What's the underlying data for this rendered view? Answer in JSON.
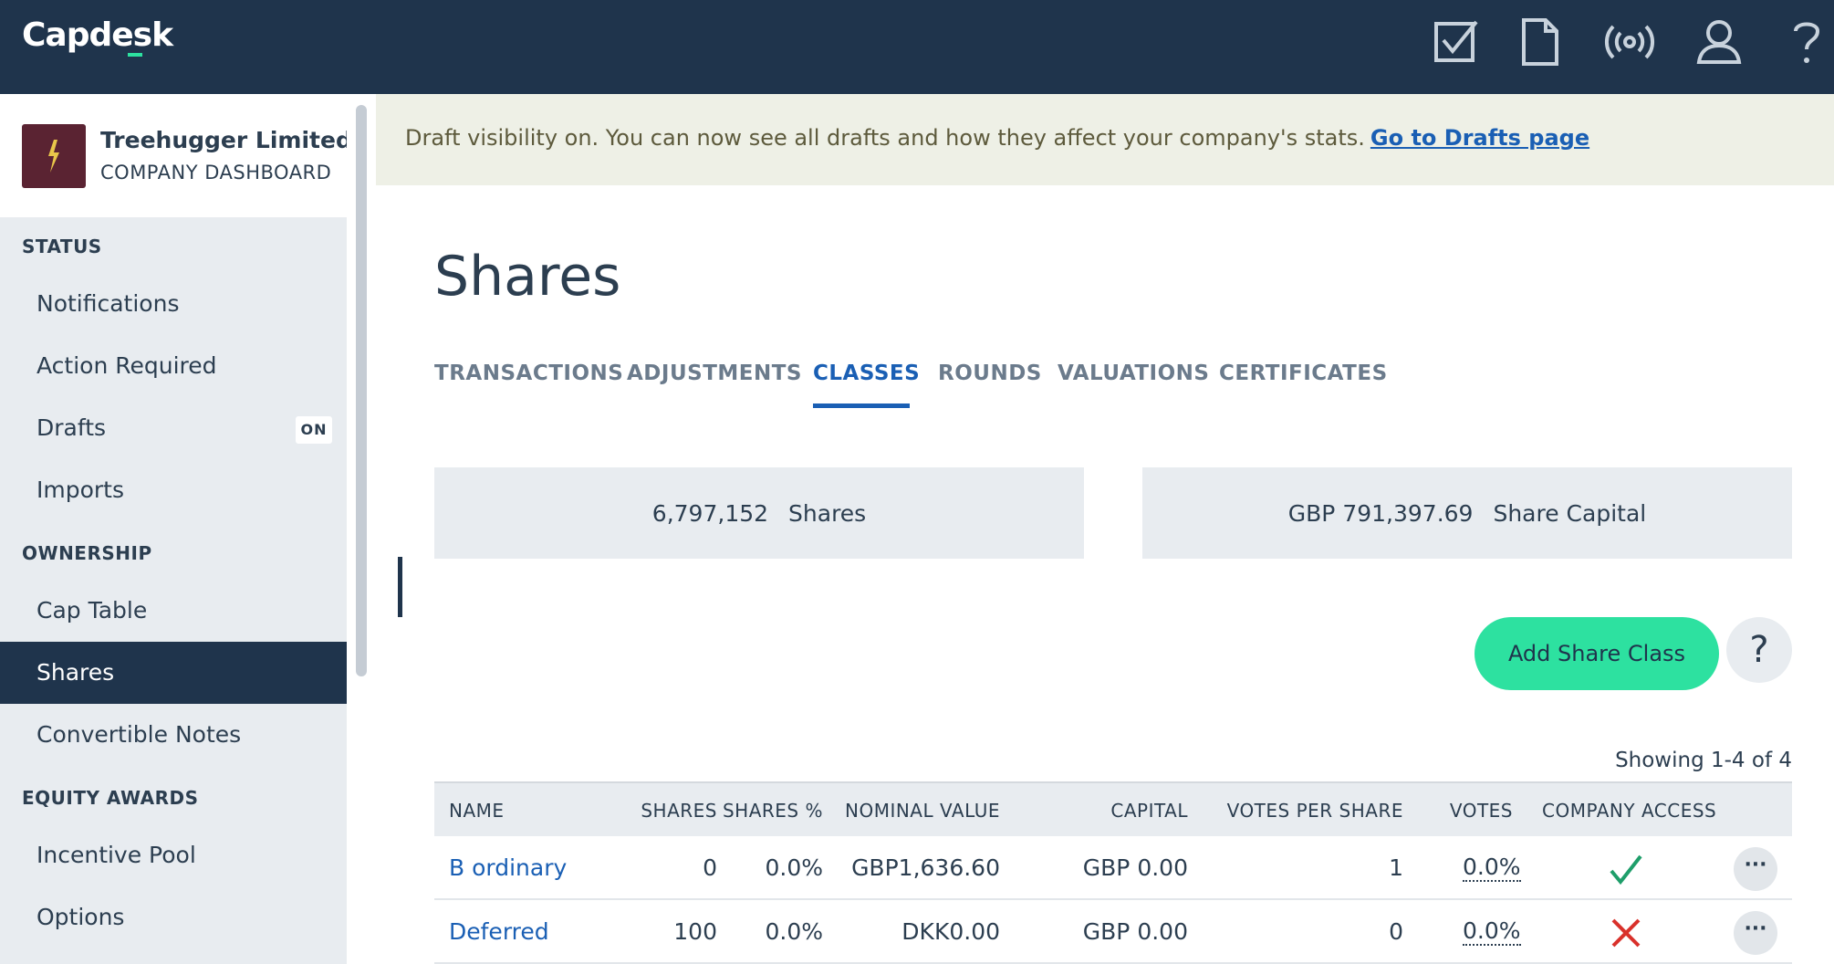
{
  "app": {
    "logo": "Capdesk"
  },
  "topbar": {
    "icons": [
      "tasks-checkbox-icon",
      "document-icon",
      "broadcast-icon",
      "user-icon",
      "help-icon"
    ]
  },
  "sidebar": {
    "company_name": "Treehugger Limited",
    "company_sub": "COMPANY DASHBOARD",
    "sections": [
      {
        "heading": "STATUS",
        "items": [
          {
            "label": "Notifications"
          },
          {
            "label": "Action Required"
          },
          {
            "label": "Drafts",
            "badge": "ON"
          },
          {
            "label": "Imports"
          }
        ]
      },
      {
        "heading": "OWNERSHIP",
        "items": [
          {
            "label": "Cap Table"
          },
          {
            "label": "Shares",
            "active": true
          },
          {
            "label": "Convertible Notes"
          }
        ]
      },
      {
        "heading": "EQUITY AWARDS",
        "items": [
          {
            "label": "Incentive Pool"
          },
          {
            "label": "Options"
          }
        ]
      }
    ]
  },
  "banner": {
    "text": "Draft visibility on. You can now see all drafts and how they affect your company's stats.",
    "link": "Go to Drafts page"
  },
  "main": {
    "title": "Shares",
    "tabs": [
      "TRANSACTIONS",
      "ADJUSTMENTS",
      "CLASSES",
      "ROUNDS",
      "VALUATIONS",
      "CERTIFICATES"
    ],
    "active_tab": "CLASSES",
    "stats": [
      {
        "value": "6,797,152",
        "label": "Shares"
      },
      {
        "value": "GBP 791,397.69",
        "label": "Share Capital"
      }
    ],
    "add_button": "Add Share Class",
    "help_button": "?",
    "showing": "Showing 1-4 of 4"
  },
  "table": {
    "columns": [
      "NAME",
      "SHARES",
      "SHARES %",
      "NOMINAL VALUE",
      "CAPITAL",
      "VOTES PER SHARE",
      "VOTES",
      "COMPANY ACCESS"
    ],
    "rows": [
      {
        "name": "B ordinary",
        "shares": "0",
        "shares_pct": "0.0%",
        "nominal": "GBP1,636.60",
        "capital": "GBP 0.00",
        "votes_per_share": "1",
        "votes": "0.0%",
        "access": "check-icon"
      },
      {
        "name": "Deferred",
        "shares": "100",
        "shares_pct": "0.0%",
        "nominal": "DKK0.00",
        "capital": "GBP 0.00",
        "votes_per_share": "0",
        "votes": "0.0%",
        "access": "cross-icon"
      }
    ],
    "more_label": "···"
  },
  "colors": {
    "topbar": "#1f344c",
    "accent_green": "#2de1a0",
    "link_blue": "#1a5fb4",
    "banner_bg": "#eef0e6",
    "check_green": "#1e9e6a",
    "cross_red": "#d9312b"
  }
}
